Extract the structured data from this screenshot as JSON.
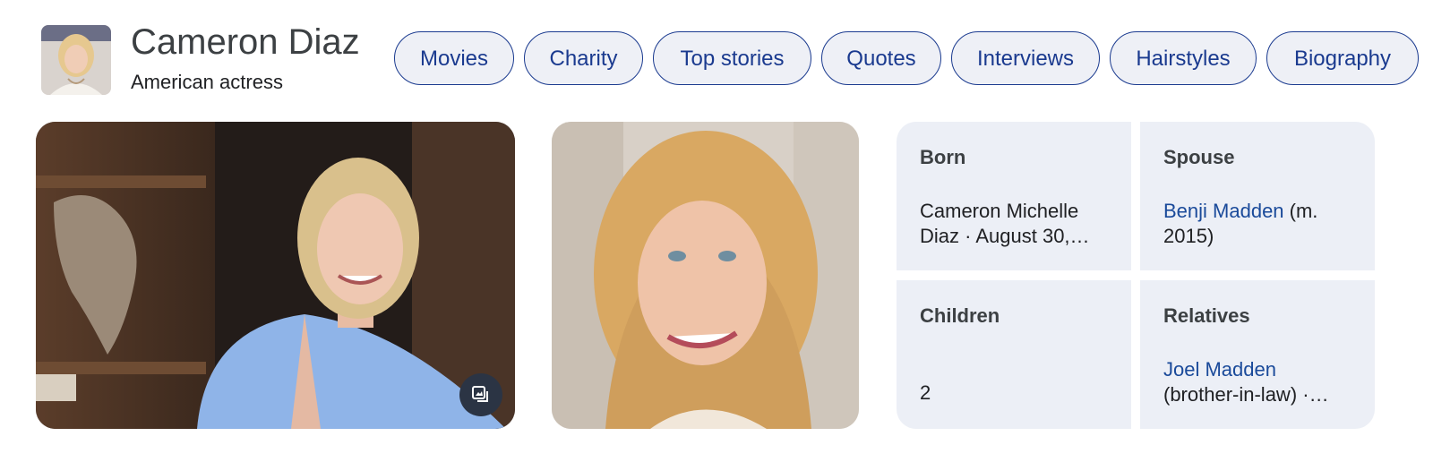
{
  "header": {
    "name": "Cameron Diaz",
    "description": "American actress"
  },
  "chips": [
    {
      "label": "Movies"
    },
    {
      "label": "Charity"
    },
    {
      "label": "Top stories"
    },
    {
      "label": "Quotes"
    },
    {
      "label": "Interviews"
    },
    {
      "label": "Hairstyles"
    },
    {
      "label": "Biography"
    }
  ],
  "facts": {
    "born": {
      "label": "Born",
      "line1": "Cameron Michelle",
      "line2": "Diaz · August 30,…"
    },
    "spouse": {
      "label": "Spouse",
      "link": "Benji Madden",
      "suffix": " (m.",
      "line2": "2015)"
    },
    "children": {
      "label": "Children",
      "value": "2"
    },
    "relatives": {
      "label": "Relatives",
      "link": "Joel Madden",
      "line2": "(brother-in-law) ·…"
    }
  },
  "icons": {
    "expand": "image-expand-icon"
  },
  "colors": {
    "chip_border": "#1a3a8f",
    "chip_bg": "#eef0f6",
    "fact_bg": "#eceff6",
    "link": "#1a4a9a"
  }
}
